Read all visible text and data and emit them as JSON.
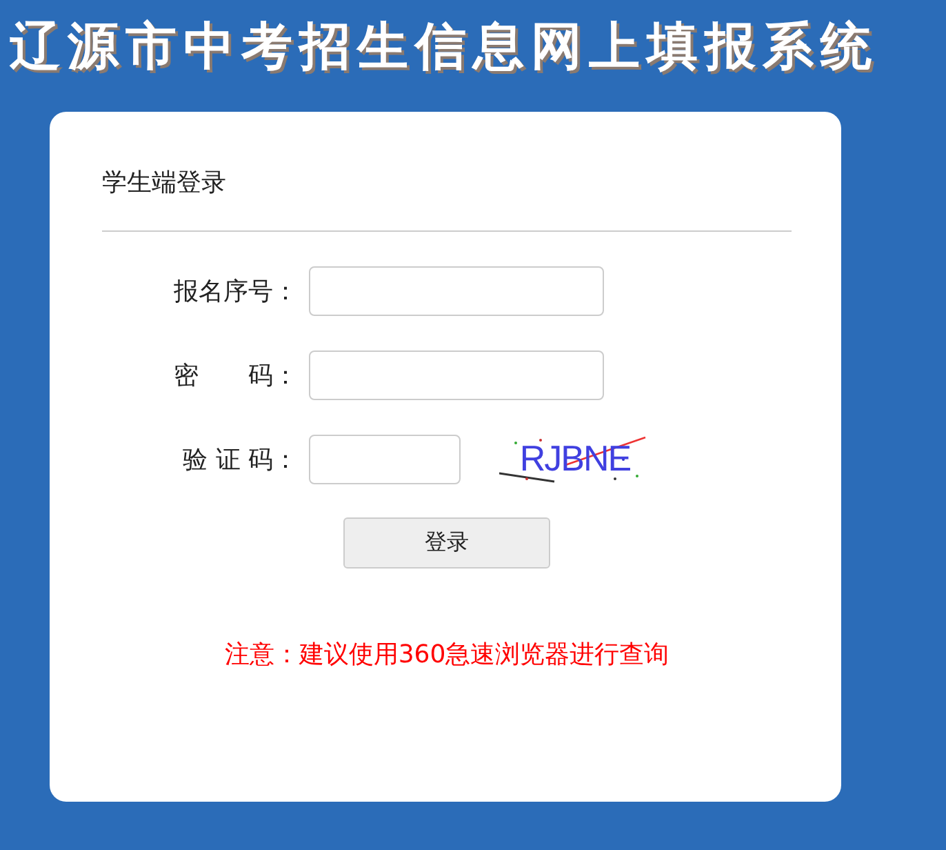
{
  "page_title": "辽源市中考招生信息网上填报系统",
  "login_panel": {
    "heading": "学生端登录",
    "fields": [
      {
        "kind": "text",
        "label": "报名序号："
      },
      {
        "kind": "password",
        "label": "密　　码："
      },
      {
        "kind": "captcha",
        "label": "验 证 码：",
        "captcha": "RJBNE"
      }
    ],
    "submit_button": "登录",
    "notice": "注意：建议使用360急速浏览器进行查询"
  }
}
